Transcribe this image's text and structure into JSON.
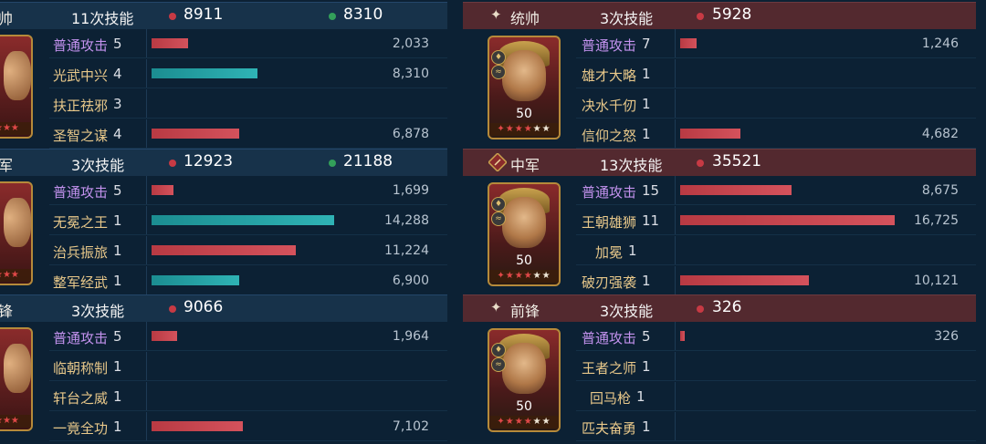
{
  "left": [
    {
      "role": "帅",
      "cast": "11次技能",
      "damage": "8911",
      "heal": "8310",
      "skills": [
        {
          "name": "普通攻击",
          "count": "5",
          "value": "2,033",
          "bar": 0.2,
          "color": "red",
          "basic": true
        },
        {
          "name": "光武中兴",
          "count": "4",
          "value": "8,310",
          "bar": 0.58,
          "color": "teal",
          "basic": false
        },
        {
          "name": "扶正祛邪",
          "count": "3",
          "value": "",
          "bar": 0,
          "color": "red",
          "basic": false
        },
        {
          "name": "圣智之谋",
          "count": "4",
          "value": "6,878",
          "bar": 0.48,
          "color": "red",
          "basic": false
        }
      ]
    },
    {
      "role": "军",
      "cast": "3次技能",
      "damage": "12923",
      "heal": "21188",
      "skills": [
        {
          "name": "普通攻击",
          "count": "5",
          "value": "1,699",
          "bar": 0.12,
          "color": "red",
          "basic": true
        },
        {
          "name": "无冕之王",
          "count": "1",
          "value": "14,288",
          "bar": 1.0,
          "color": "teal",
          "basic": false
        },
        {
          "name": "治兵振旅",
          "count": "1",
          "value": "11,224",
          "bar": 0.79,
          "color": "red",
          "basic": false
        },
        {
          "name": "整军经武",
          "count": "1",
          "value": "6,900",
          "bar": 0.48,
          "color": "teal",
          "basic": false
        }
      ]
    },
    {
      "role": "锋",
      "cast": "3次技能",
      "damage": "9066",
      "heal": "",
      "skills": [
        {
          "name": "普通攻击",
          "count": "5",
          "value": "1,964",
          "bar": 0.14,
          "color": "red",
          "basic": true
        },
        {
          "name": "临朝称制",
          "count": "1",
          "value": "",
          "bar": 0,
          "color": "red",
          "basic": false
        },
        {
          "name": "轩台之威",
          "count": "1",
          "value": "",
          "bar": 0,
          "color": "red",
          "basic": false
        },
        {
          "name": "一竟全功",
          "count": "1",
          "value": "7,102",
          "bar": 0.5,
          "color": "red",
          "basic": false
        }
      ]
    }
  ],
  "right": [
    {
      "role": "统帅",
      "icon": "sparkle-icon",
      "cast": "3次技能",
      "damage": "5928",
      "level": "50",
      "skills": [
        {
          "name": "普通攻击",
          "count": "7",
          "value": "1,246",
          "bar": 0.075,
          "basic": true
        },
        {
          "name": "雄才大略",
          "count": "1",
          "value": "",
          "bar": 0,
          "basic": false
        },
        {
          "name": "决水千仞",
          "count": "1",
          "value": "",
          "bar": 0,
          "basic": false
        },
        {
          "name": "信仰之怒",
          "count": "1",
          "value": "4,682",
          "bar": 0.28,
          "basic": false
        }
      ]
    },
    {
      "role": "中军",
      "icon": "flag-icon",
      "cast": "13次技能",
      "damage": "35521",
      "level": "50",
      "skills": [
        {
          "name": "普通攻击",
          "count": "15",
          "value": "8,675",
          "bar": 0.52,
          "basic": true
        },
        {
          "name": "王朝雄狮",
          "count": "11",
          "value": "16,725",
          "bar": 1.0,
          "basic": false
        },
        {
          "name": "加冕",
          "count": "1",
          "value": "",
          "bar": 0,
          "basic": false
        },
        {
          "name": "破刃强袭",
          "count": "1",
          "value": "10,121",
          "bar": 0.6,
          "basic": false
        }
      ]
    },
    {
      "role": "前锋",
      "icon": "sparkle-icon",
      "cast": "3次技能",
      "damage": "326",
      "level": "50",
      "skills": [
        {
          "name": "普通攻击",
          "count": "5",
          "value": "326",
          "bar": 0.02,
          "basic": true
        },
        {
          "name": "王者之师",
          "count": "1",
          "value": "",
          "bar": 0,
          "basic": false
        },
        {
          "name": "回马枪",
          "count": "1",
          "value": "",
          "bar": 0,
          "basic": false
        },
        {
          "name": "匹夫奋勇",
          "count": "1",
          "value": "",
          "bar": 0,
          "basic": false
        }
      ]
    }
  ]
}
